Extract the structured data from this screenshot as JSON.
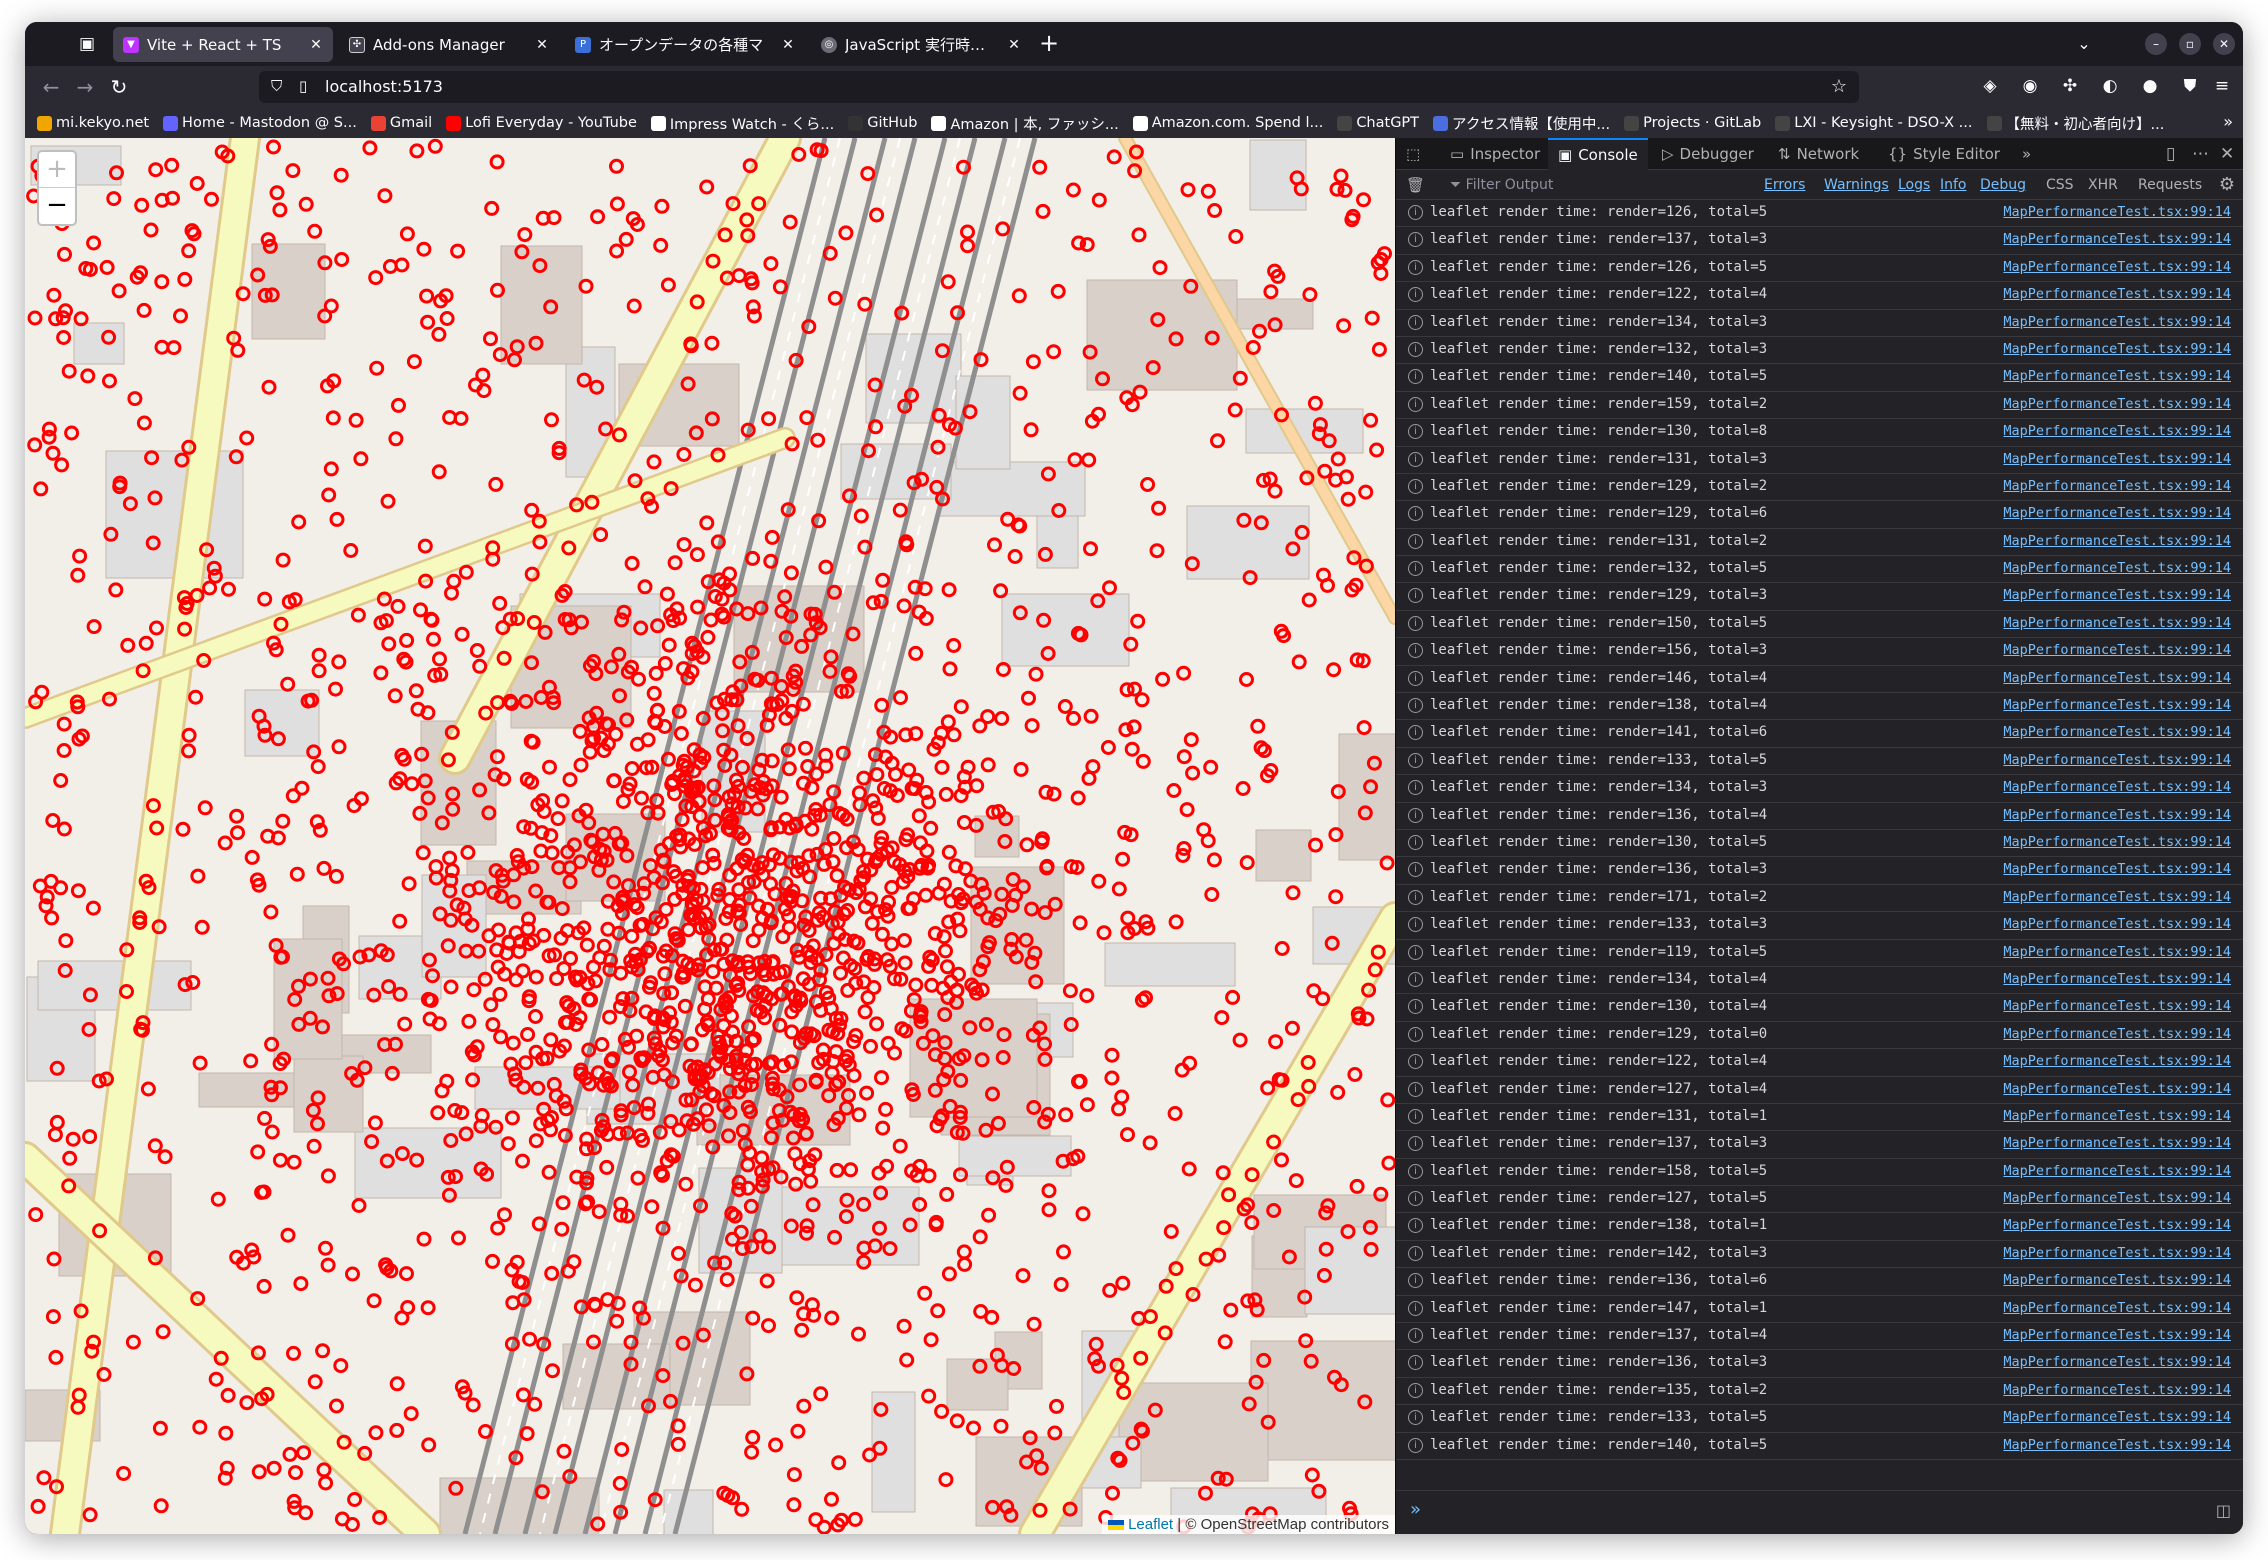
{
  "browser": {
    "tabs": [
      {
        "title": "Vite + React + TS",
        "selected": true,
        "favicon_color": "#bd34fe"
      },
      {
        "title": "Add-ons Manager",
        "selected": false,
        "favicon_color": "#42414d"
      },
      {
        "title": "オープンデータの各種マ",
        "selected": false,
        "favicon_color": "#3b6fd8"
      },
      {
        "title": "JavaScript 実行時間計測",
        "selected": false,
        "favicon_color": "#6b6b75"
      }
    ],
    "url": "localhost:5173",
    "bookmarks": [
      {
        "label": "mi.kekyo.net",
        "color": "#f0a500"
      },
      {
        "label": "Home - Mastodon @ S...",
        "color": "#6364ff"
      },
      {
        "label": "Gmail",
        "color": "#ea4335"
      },
      {
        "label": "Lofi Everyday - YouTube",
        "color": "#ff0000"
      },
      {
        "label": "Impress Watch - くら...",
        "color": "#ffffff"
      },
      {
        "label": "GitHub",
        "color": "#333333"
      },
      {
        "label": "Amazon | 本, ファッシ...",
        "color": "#ffffff"
      },
      {
        "label": "Amazon.com. Spend l...",
        "color": "#ffffff"
      },
      {
        "label": "ChatGPT",
        "color": "#444444"
      },
      {
        "label": "アクセス情報【使用中...",
        "color": "#4a6ee0"
      },
      {
        "label": "Projects · GitLab",
        "color": "#444444"
      },
      {
        "label": "LXI - Keysight - DSO-X ...",
        "color": "#444444"
      },
      {
        "label": "【無料・初心者向け】...",
        "color": "#444444"
      }
    ]
  },
  "map": {
    "zoom_in": "+",
    "zoom_out": "−",
    "attribution_leaflet": "Leaflet",
    "attribution_osm": "| © OpenStreetMap contributors",
    "marker_color": "#ff0000"
  },
  "devtools": {
    "tabs": [
      {
        "label": "Inspector",
        "selected": false
      },
      {
        "label": "Console",
        "selected": true
      },
      {
        "label": "Debugger",
        "selected": false
      },
      {
        "label": "Network",
        "selected": false
      },
      {
        "label": "Style Editor",
        "selected": false
      }
    ],
    "filter_placeholder": "Filter Output",
    "filters": [
      {
        "label": "Errors",
        "on": true
      },
      {
        "label": "Warnings",
        "on": true
      },
      {
        "label": "Logs",
        "on": true
      },
      {
        "label": "Info",
        "on": true
      },
      {
        "label": "Debug",
        "on": true
      },
      {
        "label": "CSS",
        "on": false
      },
      {
        "label": "XHR",
        "on": false
      },
      {
        "label": "Requests",
        "on": false
      }
    ],
    "log_source": "MapPerformanceTest.tsx:99:14",
    "logs": [
      "leaflet render time: render=126, total=5",
      "leaflet render time: render=137, total=3",
      "leaflet render time: render=126, total=5",
      "leaflet render time: render=122, total=4",
      "leaflet render time: render=134, total=3",
      "leaflet render time: render=132, total=3",
      "leaflet render time: render=140, total=5",
      "leaflet render time: render=159, total=2",
      "leaflet render time: render=130, total=8",
      "leaflet render time: render=131, total=3",
      "leaflet render time: render=129, total=2",
      "leaflet render time: render=129, total=6",
      "leaflet render time: render=131, total=2",
      "leaflet render time: render=132, total=5",
      "leaflet render time: render=129, total=3",
      "leaflet render time: render=150, total=5",
      "leaflet render time: render=156, total=3",
      "leaflet render time: render=146, total=4",
      "leaflet render time: render=138, total=4",
      "leaflet render time: render=141, total=6",
      "leaflet render time: render=133, total=5",
      "leaflet render time: render=134, total=3",
      "leaflet render time: render=136, total=4",
      "leaflet render time: render=130, total=5",
      "leaflet render time: render=136, total=3",
      "leaflet render time: render=171, total=2",
      "leaflet render time: render=133, total=3",
      "leaflet render time: render=119, total=5",
      "leaflet render time: render=134, total=4",
      "leaflet render time: render=130, total=4",
      "leaflet render time: render=129, total=0",
      "leaflet render time: render=122, total=4",
      "leaflet render time: render=127, total=4",
      "leaflet render time: render=131, total=1",
      "leaflet render time: render=137, total=3",
      "leaflet render time: render=158, total=5",
      "leaflet render time: render=127, total=5",
      "leaflet render time: render=138, total=1",
      "leaflet render time: render=142, total=3",
      "leaflet render time: render=136, total=6",
      "leaflet render time: render=147, total=1",
      "leaflet render time: render=137, total=4",
      "leaflet render time: render=136, total=3",
      "leaflet render time: render=135, total=2",
      "leaflet render time: render=133, total=5",
      "leaflet render time: render=140, total=5"
    ]
  }
}
